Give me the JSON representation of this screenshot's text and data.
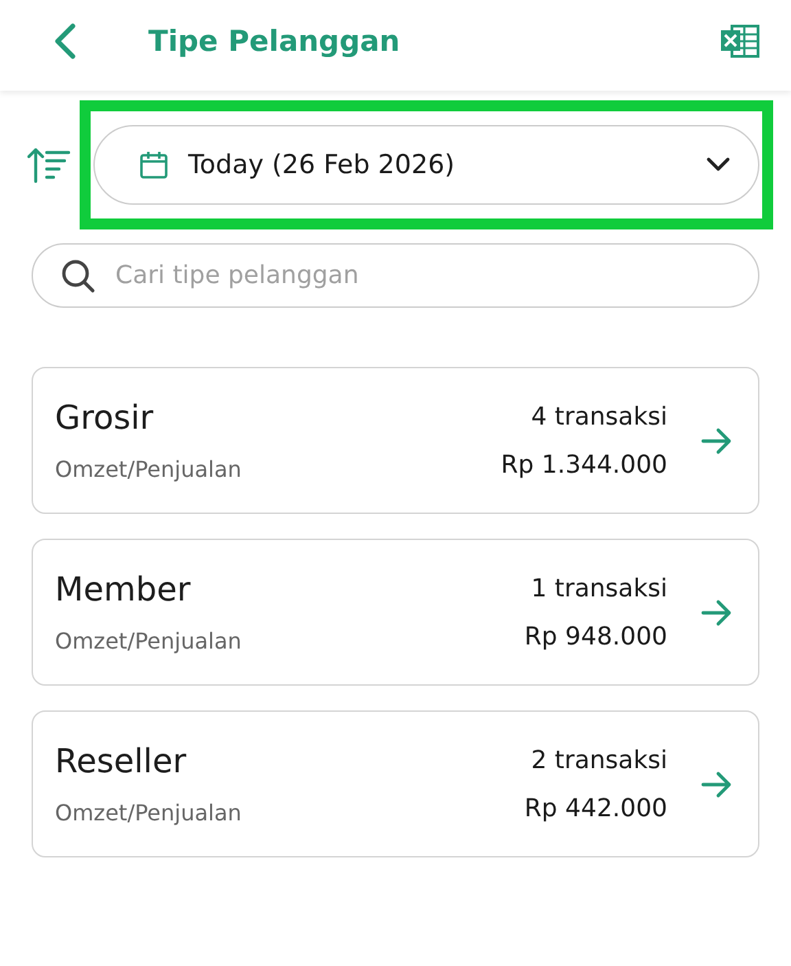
{
  "header": {
    "title": "Tipe Pelanggan"
  },
  "date_filter": {
    "value": "Today (26 Feb 2026)",
    "highlighted": true
  },
  "search": {
    "placeholder": "Cari tipe pelanggan"
  },
  "customer_types": [
    {
      "name": "Grosir",
      "transactions": "4 transaksi",
      "revenue_label": "Omzet/Penjualan",
      "revenue": "Rp 1.344.000"
    },
    {
      "name": "Member",
      "transactions": "1 transaksi",
      "revenue_label": "Omzet/Penjualan",
      "revenue": "Rp 948.000"
    },
    {
      "name": "Reseller",
      "transactions": "2 transaksi",
      "revenue_label": "Omzet/Penjualan",
      "revenue": "Rp 442.000"
    }
  ]
}
